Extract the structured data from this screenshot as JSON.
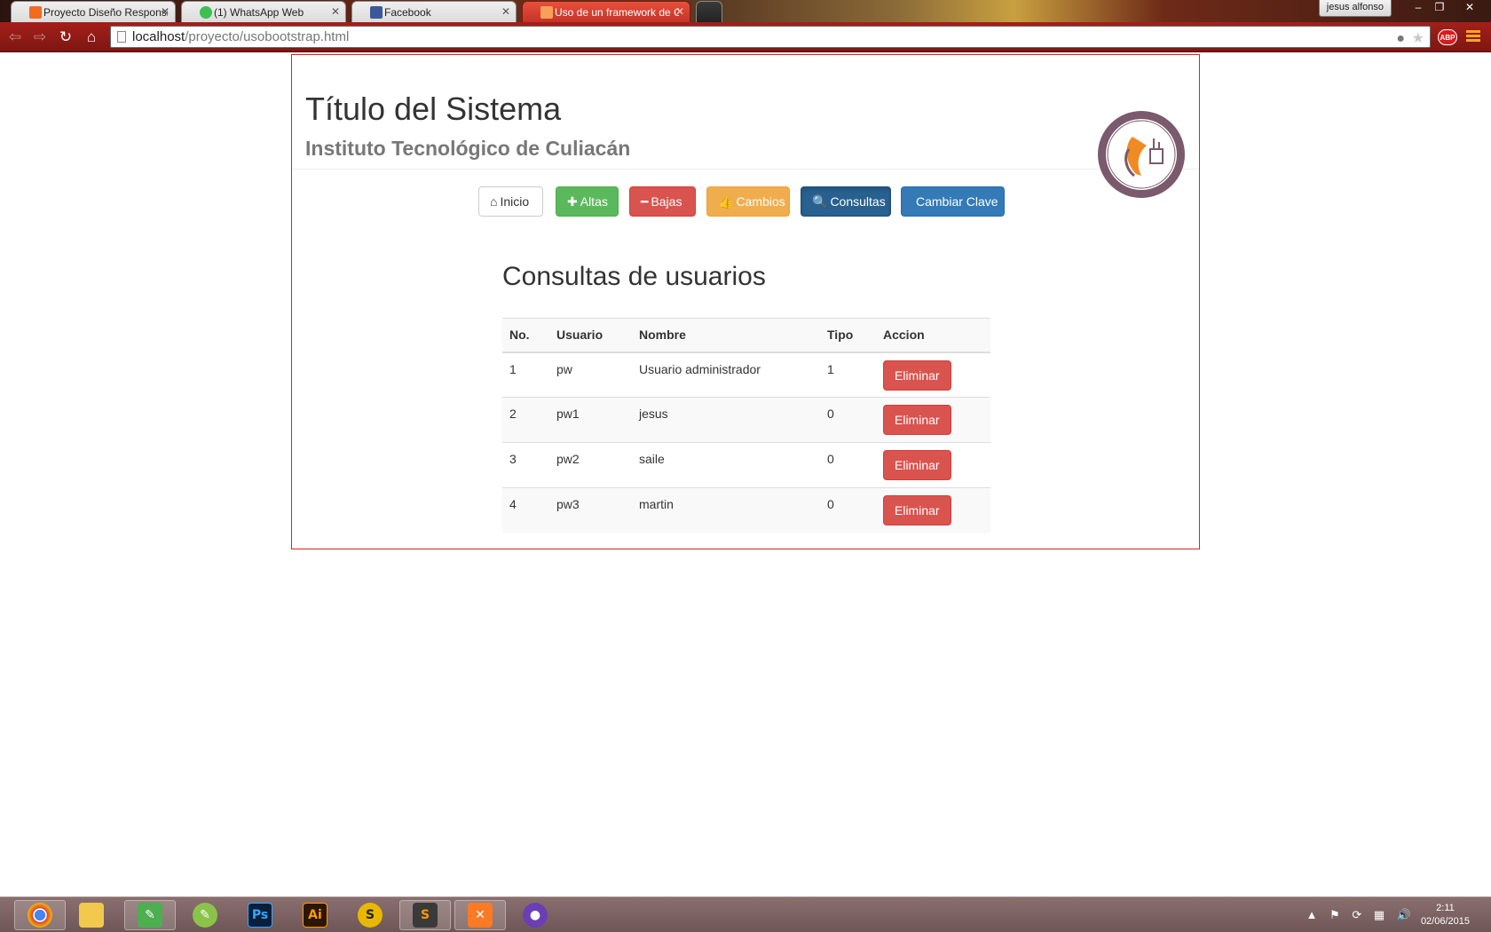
{
  "browser": {
    "tabs": [
      {
        "label": "Proyecto Diseño Responsi",
        "favicon": "xampp-icon",
        "active": false
      },
      {
        "label": "(1) WhatsApp Web",
        "favicon": "whatsapp-icon",
        "active": false
      },
      {
        "label": "Facebook",
        "favicon": "facebook-icon",
        "active": false
      },
      {
        "label": "Uso de un framework de C",
        "favicon": "xampp-icon",
        "active": true
      }
    ],
    "user_name": "jesus alfonso",
    "url_host": "localhost",
    "url_path": "/proyecto/usobootstrap.html",
    "extension_label": "ABP"
  },
  "header": {
    "title": "Título del Sistema",
    "subtitle": "Instituto Tecnológico de Culiacán"
  },
  "nav_buttons": {
    "inicio": "Inicio",
    "altas": "Altas",
    "bajas": "Bajas",
    "cambios": "Cambios",
    "consultas": "Consultas",
    "cambiar_clave": "Cambiar Clave"
  },
  "section": {
    "title": "Consultas de usuarios"
  },
  "table": {
    "columns": [
      "No.",
      "Usuario",
      "Nombre",
      "Tipo",
      "Accion"
    ],
    "rows": [
      {
        "no": "1",
        "usuario": "pw",
        "nombre": "Usuario administrador",
        "tipo": "1",
        "accion": "Eliminar"
      },
      {
        "no": "2",
        "usuario": "pw1",
        "nombre": "jesus",
        "tipo": "0",
        "accion": "Eliminar"
      },
      {
        "no": "3",
        "usuario": "pw2",
        "nombre": "saile",
        "tipo": "0",
        "accion": "Eliminar"
      },
      {
        "no": "4",
        "usuario": "pw3",
        "nombre": "martin",
        "tipo": "0",
        "accion": "Eliminar"
      }
    ]
  },
  "taskbar": {
    "apps": [
      "chrome-icon",
      "file-explorer-icon",
      "coreldraw-icon",
      "corel-icon",
      "photoshop-icon",
      "illustrator-icon",
      "sublime-alt-icon",
      "sublime-text-icon",
      "xampp-icon",
      "cat-app-icon"
    ],
    "photoshop_label": "Ps",
    "illustrator_label": "Ai",
    "time": "2:11",
    "date": "02/06/2015"
  },
  "colors": {
    "container_border": "#e02020",
    "success": "#5cb85c",
    "danger": "#d9534f",
    "warning": "#f0ad4e",
    "primary": "#337ab7"
  }
}
